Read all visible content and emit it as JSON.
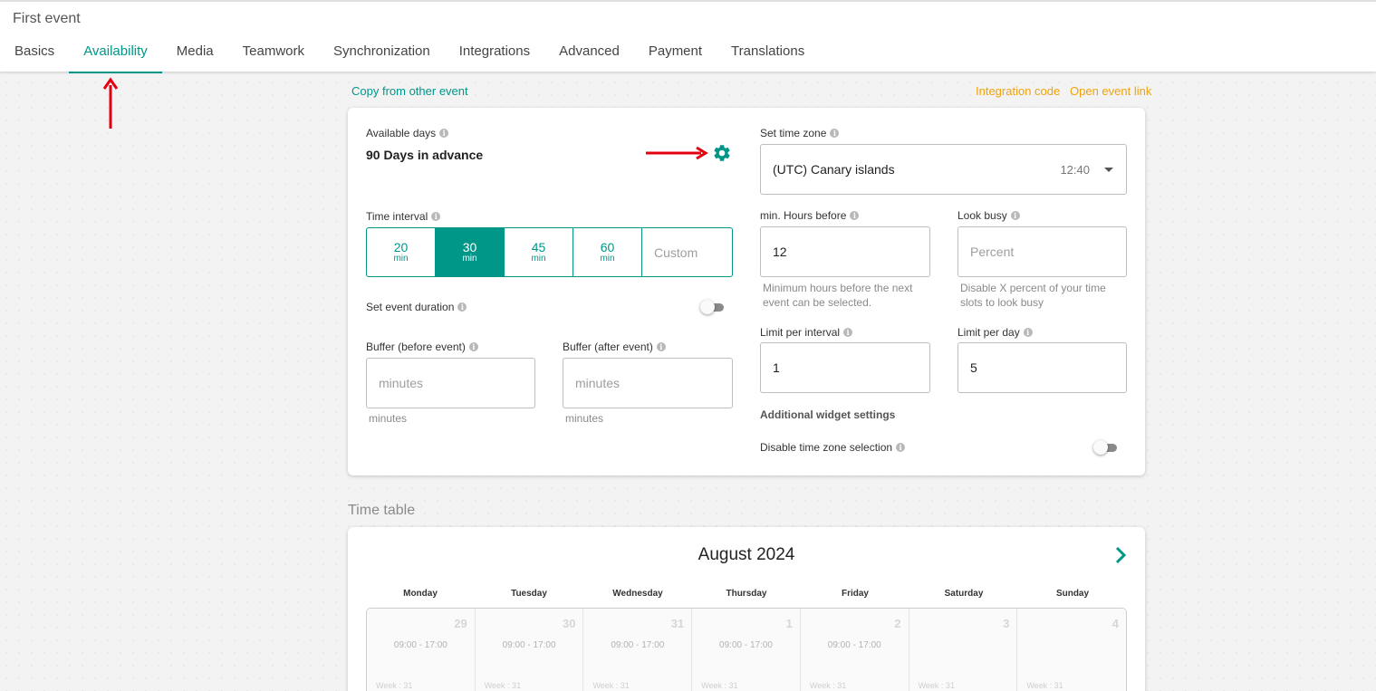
{
  "event_title": "First event",
  "tabs": [
    {
      "label": "Basics"
    },
    {
      "label": "Availability",
      "active": true
    },
    {
      "label": "Media"
    },
    {
      "label": "Teamwork"
    },
    {
      "label": "Synchronization"
    },
    {
      "label": "Integrations"
    },
    {
      "label": "Advanced"
    },
    {
      "label": "Payment"
    },
    {
      "label": "Translations"
    }
  ],
  "links": {
    "copy": "Copy from other event",
    "integration_code": "Integration code",
    "open_event_link": "Open event link"
  },
  "available_days": {
    "label": "Available days",
    "value": "90 Days in advance"
  },
  "time_interval": {
    "label": "Time interval",
    "options": [
      {
        "num": "20",
        "unit": "min"
      },
      {
        "num": "30",
        "unit": "min",
        "active": true
      },
      {
        "num": "45",
        "unit": "min"
      },
      {
        "num": "60",
        "unit": "min"
      }
    ],
    "custom_placeholder": "Custom"
  },
  "event_duration": {
    "label": "Set event duration",
    "enabled": false
  },
  "buffer_before": {
    "label": "Buffer (before event)",
    "placeholder": "minutes",
    "help": "minutes"
  },
  "buffer_after": {
    "label": "Buffer (after event)",
    "placeholder": "minutes",
    "help": "minutes"
  },
  "time_zone": {
    "label": "Set time zone",
    "value": "(UTC) Canary islands",
    "time": "12:40"
  },
  "min_hours": {
    "label": "min. Hours before",
    "value": "12",
    "help": "Minimum hours before the next event can be selected."
  },
  "look_busy": {
    "label": "Look busy",
    "placeholder": "Percent",
    "help": "Disable X percent of your time slots to look busy"
  },
  "limit_interval": {
    "label": "Limit per interval",
    "value": "1"
  },
  "limit_day": {
    "label": "Limit per day",
    "value": "5"
  },
  "widget_settings": {
    "title": "Additional widget settings",
    "disable_tz_label": "Disable time zone selection",
    "enabled": false
  },
  "timetable": {
    "title": "Time table",
    "month": "August 2024",
    "weekdays": [
      "Monday",
      "Tuesday",
      "Wednesday",
      "Thursday",
      "Friday",
      "Saturday",
      "Sunday"
    ],
    "days": [
      {
        "num": "29",
        "hours": "09:00 - 17:00",
        "week": "Week : 31"
      },
      {
        "num": "30",
        "hours": "09:00 - 17:00",
        "week": "Week : 31"
      },
      {
        "num": "31",
        "hours": "09:00 - 17:00",
        "week": "Week : 31"
      },
      {
        "num": "1",
        "hours": "09:00 - 17:00",
        "week": "Week : 31"
      },
      {
        "num": "2",
        "hours": "09:00 - 17:00",
        "week": "Week : 31"
      },
      {
        "num": "3",
        "hours": "",
        "week": "Week : 31"
      },
      {
        "num": "4",
        "hours": "",
        "week": "Week : 31"
      }
    ]
  },
  "colors": {
    "accent": "#009688",
    "link_orange": "#f0a30a",
    "annotation": "#e3000f"
  }
}
